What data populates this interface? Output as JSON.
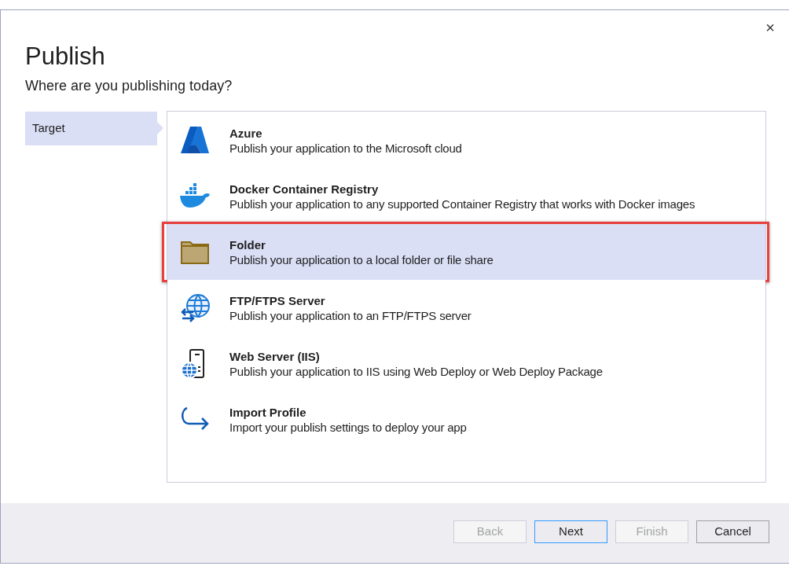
{
  "dialog": {
    "title": "Publish",
    "subtitle": "Where are you publishing today?",
    "close": "×"
  },
  "steps": [
    {
      "label": "Target",
      "selected": true
    }
  ],
  "targets": [
    {
      "kind": "azure",
      "title": "Azure",
      "description": "Publish your application to the Microsoft cloud",
      "selected": false,
      "highlighted": false
    },
    {
      "kind": "docker",
      "title": "Docker Container Registry",
      "description": "Publish your application to any supported Container Registry that works with Docker images",
      "selected": false,
      "highlighted": false
    },
    {
      "kind": "folder",
      "title": "Folder",
      "description": "Publish your application to a local folder or file share",
      "selected": true,
      "highlighted": true
    },
    {
      "kind": "ftp",
      "title": "FTP/FTPS Server",
      "description": "Publish your application to an FTP/FTPS server",
      "selected": false,
      "highlighted": false
    },
    {
      "kind": "iis",
      "title": "Web Server (IIS)",
      "description": "Publish your application to IIS using Web Deploy or Web Deploy Package",
      "selected": false,
      "highlighted": false
    },
    {
      "kind": "import",
      "title": "Import Profile",
      "description": "Import your publish settings to deploy your app",
      "selected": false,
      "highlighted": false
    }
  ],
  "buttons": [
    {
      "label": "Back",
      "disabled": true,
      "default": false
    },
    {
      "label": "Next",
      "disabled": false,
      "default": true
    },
    {
      "label": "Finish",
      "disabled": true,
      "default": false
    },
    {
      "label": "Cancel",
      "disabled": false,
      "default": false
    }
  ]
}
